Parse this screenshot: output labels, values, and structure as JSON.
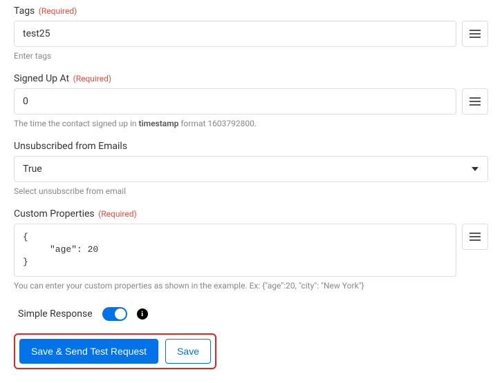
{
  "fields": {
    "tags": {
      "label": "Tags",
      "required_text": "(Required)",
      "value": "test25",
      "help": "Enter tags"
    },
    "signed_up": {
      "label": "Signed Up At",
      "required_text": "(Required)",
      "value": "0",
      "help_prefix": "The time the contact signed up in ",
      "help_bold": "timestamp",
      "help_suffix": " format 1603792800."
    },
    "unsubscribed": {
      "label": "Unsubscribed from Emails",
      "value": "True",
      "help": "Select unsubscribe from email"
    },
    "custom_props": {
      "label": "Custom Properties",
      "required_text": "(Required)",
      "value": "{\n     \"age\": 20\n}",
      "help": "You can enter your custom properties as shown in the example. Ex: {\"age\":20, \"city\": \"New York\"}"
    }
  },
  "simple_response": {
    "label": "Simple Response",
    "enabled": true
  },
  "buttons": {
    "primary": "Save & Send Test Request",
    "secondary": "Save"
  }
}
